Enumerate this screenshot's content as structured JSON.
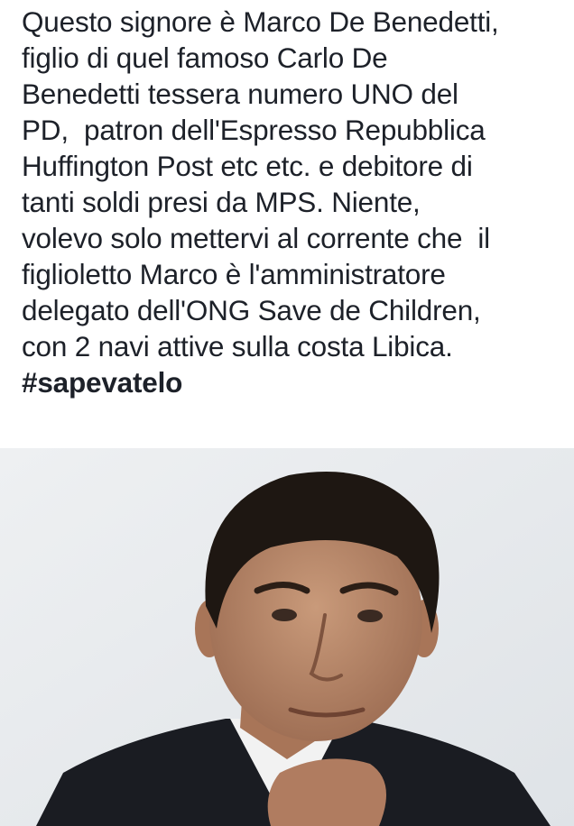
{
  "post": {
    "text_lines": [
      "Questo signore è Marco De Benedetti,",
      "figlio di quel famoso Carlo De",
      "Benedetti tessera numero UNO del",
      "PD,  patron dell'Espresso Repubblica",
      "Huffington Post etc etc. e debitore di",
      "tanti soldi presi da MPS. Niente,",
      "volevo solo mettervi al corrente che  il",
      "figlioletto Marco è l'amministratore",
      "delegato dell'ONG Save de Children,",
      "con 2 navi attive sulla costa Libica."
    ],
    "hashtag": "#sapevatelo"
  },
  "colors": {
    "text": "#1d2129",
    "photo_background": "#e9ecef",
    "hair": "#1e1712",
    "skin": "#b98a6c",
    "suit": "#1a1c22",
    "shirt": "#f2f2f2"
  }
}
